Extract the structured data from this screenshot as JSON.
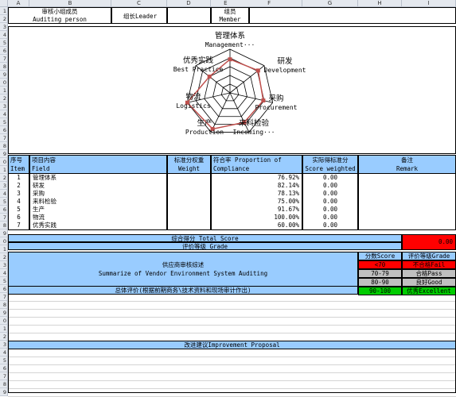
{
  "columns": [
    "A",
    "B",
    "C",
    "D",
    "E",
    "F",
    "G",
    "H",
    "I"
  ],
  "row_numbers": [
    "1",
    "2",
    "3",
    "4",
    "5",
    "6",
    "7",
    "8",
    "9",
    "0",
    "1",
    "2",
    "3",
    "4",
    "5",
    "6",
    "7",
    "8",
    "9",
    "0",
    "1",
    "2",
    "3",
    "4",
    "5",
    "6",
    "7",
    "8",
    "9",
    "0",
    "1",
    "2",
    "3",
    "4",
    "5",
    "6",
    "7",
    "8",
    "9",
    "0",
    "1",
    "2",
    "3",
    "4",
    "5",
    "6",
    "7",
    "8",
    "9"
  ],
  "header": {
    "team_cn": "审核小组成员",
    "team_en": "Auditing person",
    "leader": "组长Leader",
    "member_cn": "组员",
    "member_en": "Member"
  },
  "radar": {
    "labels": [
      {
        "cn": "管理体系",
        "en": "Management···"
      },
      {
        "cn": "研发",
        "en": "Development"
      },
      {
        "cn": "采购",
        "en": "Procurement"
      },
      {
        "cn": "来料检验",
        "en": "Incoming···"
      },
      {
        "cn": "生产",
        "en": "Production"
      },
      {
        "cn": "物流",
        "en": "Logistics"
      },
      {
        "cn": "优秀实践",
        "en": "Best Practice"
      }
    ],
    "values": [
      0.7692,
      0.8214,
      0.7813,
      0.75,
      0.9167,
      1.0,
      0.6
    ],
    "colors": {
      "series": "#c0504d",
      "grid": "#000000"
    }
  },
  "table": {
    "headers": {
      "no_cn": "序号",
      "no_en": "Item",
      "field_cn": "项目内容",
      "field_en": "Field",
      "weight_cn": "标准分权重",
      "weight_en": "Weight",
      "compliance_cn": "符合率 Proportion of",
      "compliance_en": "Compliance",
      "score_cn": "实际得标准分",
      "score_en": "Score weighted",
      "remark_cn": "备注",
      "remark_en": "Remark"
    },
    "rows": [
      {
        "no": "1",
        "field": "管理体系",
        "compliance": "76.92%",
        "score": "0.00"
      },
      {
        "no": "2",
        "field": "研发",
        "compliance": "82.14%",
        "score": "0.00"
      },
      {
        "no": "3",
        "field": "采购",
        "compliance": "78.13%",
        "score": "0.00"
      },
      {
        "no": "4",
        "field": "来料检验",
        "compliance": "75.00%",
        "score": "0.00"
      },
      {
        "no": "5",
        "field": "生产",
        "compliance": "91.67%",
        "score": "0.00"
      },
      {
        "no": "6",
        "field": "物流",
        "compliance": "100.00%",
        "score": "0.00"
      },
      {
        "no": "7",
        "field": "优秀实践",
        "compliance": "60.00%",
        "score": "0.00"
      }
    ],
    "total_label": "综合得分 Total Score",
    "total_value": "0.00",
    "grade_label": "评价等级 Grade"
  },
  "summary": {
    "cn": "供应商审核综述",
    "en": "Summarize of Vendor Environment System Auditing",
    "score_header": "分数Score",
    "grade_header": "评价等级Grade",
    "grades": [
      {
        "score": "<70",
        "grade": "不合格Fail",
        "bg": "#ff0000"
      },
      {
        "score": "70-79",
        "grade": "合格Pass",
        "bg": "#c0c0c0"
      },
      {
        "score": "80-90",
        "grade": "良好Good",
        "bg": "#c0c0c0"
      },
      {
        "score": "90-100",
        "grade": "优秀Excellent",
        "bg": "#00cc00"
      }
    ],
    "overall": "总体评价(根据前期商务\\技术资料和现场审计作出)"
  },
  "improvement": "改进建议Improvement Proposal"
}
